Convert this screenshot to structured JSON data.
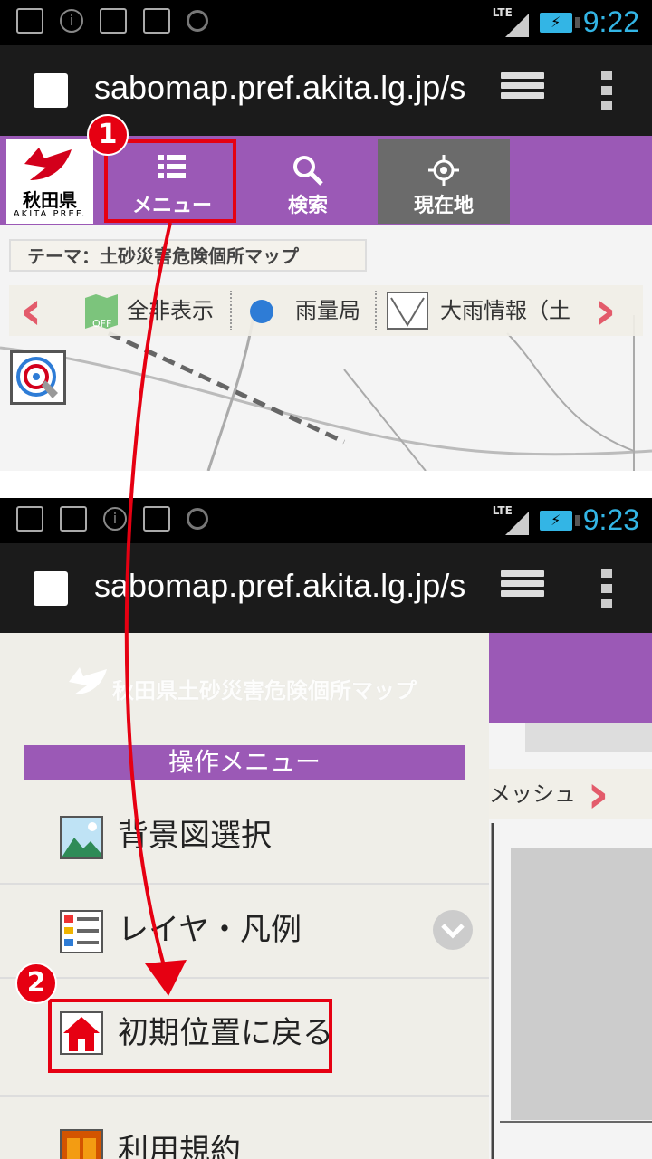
{
  "screen1": {
    "status_time": "9:22",
    "network": "LTE",
    "url": "sabomap.pref.akita.lg.jp/s",
    "logo": {
      "text": "秋田県",
      "sub": "AKITA PREF."
    },
    "nav": [
      {
        "label": "メニュー",
        "icon": "list-icon"
      },
      {
        "label": "検索",
        "icon": "search-icon"
      },
      {
        "label": "現在地",
        "icon": "crosshair-icon"
      }
    ],
    "theme_label": "テーマ：土砂災害危険個所マップ",
    "layers": [
      {
        "label": "全非表示",
        "icon": "map-off-icon"
      },
      {
        "label": "雨量局",
        "icon": "blue-dot-icon"
      },
      {
        "label": "大雨情報（土",
        "icon": "envelope-icon"
      }
    ]
  },
  "screen2": {
    "status_time": "9:23",
    "network": "LTE",
    "url": "sabomap.pref.akita.lg.jp/s",
    "drawer_title": "秋田県土砂災害危険個所マップ",
    "menu_header": "操作メニュー",
    "menu_items": [
      {
        "label": "背景図選択",
        "icon": "landscape-icon"
      },
      {
        "label": "レイヤ・凡例",
        "icon": "legend-icon"
      },
      {
        "label": "初期位置に戻る",
        "icon": "home-icon"
      },
      {
        "label": "利用規約",
        "icon": "book-icon"
      }
    ],
    "map_peek_label": "メッシュ"
  },
  "annotations": {
    "step1": "1",
    "step2": "2"
  },
  "colors": {
    "purple": "#9b59b6",
    "annotation_red": "#e60012",
    "clock_blue": "#33b5e5"
  }
}
